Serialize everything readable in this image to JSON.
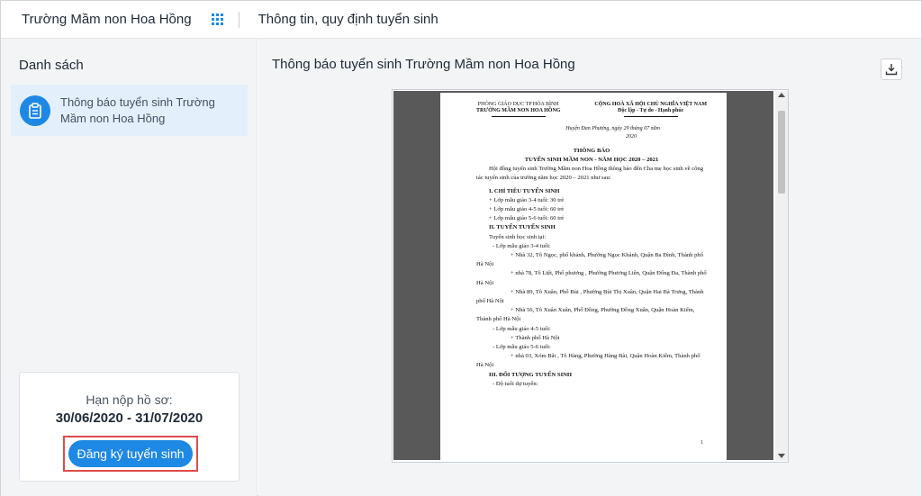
{
  "header": {
    "school_name": "Trường Mầm non Hoa Hồng",
    "page_title": "Thông tin, quy định tuyển sinh"
  },
  "sidebar": {
    "heading": "Danh sách",
    "items": [
      {
        "label": "Thông báo tuyển sinh Trường Mầm non Hoa Hồng",
        "icon": "clipboard-icon"
      }
    ],
    "deadline": {
      "label": "Hạn nộp hồ sơ:",
      "dates": "30/06/2020 - 31/07/2020"
    },
    "register_label": "Đăng ký tuyển sinh"
  },
  "main": {
    "doc_title": "Thông báo tuyển sinh Trường Mầm non Hoa Hồng",
    "download_icon": "download-icon"
  },
  "document": {
    "org_line1": "PHÒNG GIÁO DỤC TP HÒA BÌNH",
    "org_line2": "TRƯỜNG MẦM NON HOA HỒNG",
    "nation_line1": "CỘNG HOÀ XÃ HỘI CHỦ NGHĨA VIỆT NAM",
    "nation_line2": "Độc lập - Tự do - Hạnh phúc",
    "place_date": "Huyện Đan Phượng, ngày 29 tháng 07 năm",
    "year": "2020",
    "title": "THÔNG BÁO",
    "subtitle": "TUYỂN SINH MẦM NON - NĂM HỌC 2020 – 2021",
    "intro": "Hội đồng tuyển sinh Trường Mầm non Hoa Hồng thông báo đến Cha mẹ học sinh về công tác tuyển sinh của trường năm học 2020 – 2021 như sau:",
    "sec1": "I. CHỈ TIÊU TUYỂN SINH",
    "quota": [
      "+ Lớp mẫu giáo 3-4 tuổi: 30 trẻ",
      "+ Lớp mẫu giáo 4-5 tuổi: 60 trẻ",
      "+ Lớp mẫu giáo 5-6 tuổi: 60 trẻ"
    ],
    "sec2": "II. TUYỂN TUYỂN SINH",
    "at": "Tuyển sinh học sinh tại:",
    "g1": "- Lớp mẫu giáo 3-4 tuổi:",
    "g1_items": [
      "+ Nhà 32, Tô Ngọc, phố khánh, Phường Ngọc Khánh, Quận Ba Đình, Thành phố Hà Nội",
      "+ nhà 78, Tô Liệt, Phố phương , Phường Phương Liên, Quận Đống Đa, Thành phố Hà Nội",
      "+ Nhà 89, Tô Xuân, Phố Bùi , Phường Bùi Thị Xuân, Quận Hai Bà Trưng, Thành phố Hà Nội",
      "+ Nhà 56, Tô Xuân Xuân, Phố Đồng, Phường Đồng Xuân, Quận Hoàn Kiếm, Thành phố Hà Nội"
    ],
    "g2": "- Lớp mẫu giáo 4-5 tuổi:",
    "g2_items": [
      "+ Thành phố Hà Nội"
    ],
    "g3": "- Lớp mẫu giáo 5-6 tuổi:",
    "g3_items": [
      "+ nhà 03, Xóm Bãi , Tô Hàng, Phường Hàng Bài, Quận Hoàn Kiếm, Thành phố Hà Nội"
    ],
    "sec3": "III. ĐỐI TƯỢNG TUYỂN SINH",
    "age": "- Độ tuổi dự tuyển:",
    "page_number": "1"
  }
}
